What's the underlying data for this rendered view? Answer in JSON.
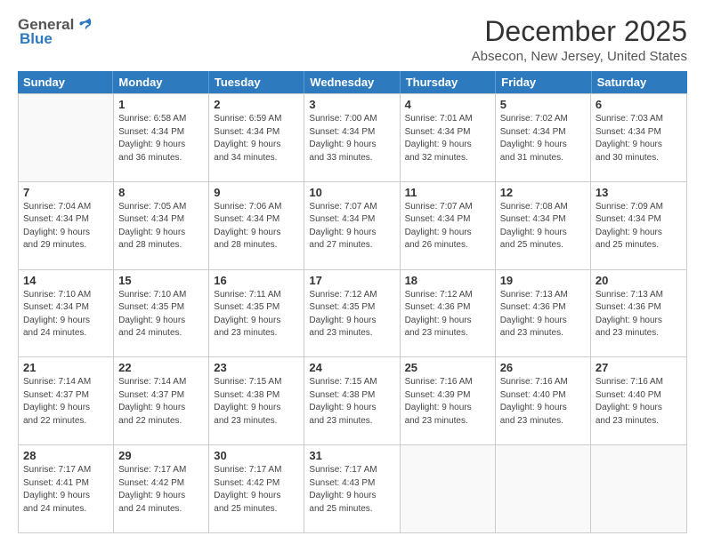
{
  "logo": {
    "general": "General",
    "blue": "Blue"
  },
  "title": "December 2025",
  "location": "Absecon, New Jersey, United States",
  "days_of_week": [
    "Sunday",
    "Monday",
    "Tuesday",
    "Wednesday",
    "Thursday",
    "Friday",
    "Saturday"
  ],
  "rows": [
    [
      {
        "day": "",
        "info": ""
      },
      {
        "day": "1",
        "info": "Sunrise: 6:58 AM\nSunset: 4:34 PM\nDaylight: 9 hours\nand 36 minutes."
      },
      {
        "day": "2",
        "info": "Sunrise: 6:59 AM\nSunset: 4:34 PM\nDaylight: 9 hours\nand 34 minutes."
      },
      {
        "day": "3",
        "info": "Sunrise: 7:00 AM\nSunset: 4:34 PM\nDaylight: 9 hours\nand 33 minutes."
      },
      {
        "day": "4",
        "info": "Sunrise: 7:01 AM\nSunset: 4:34 PM\nDaylight: 9 hours\nand 32 minutes."
      },
      {
        "day": "5",
        "info": "Sunrise: 7:02 AM\nSunset: 4:34 PM\nDaylight: 9 hours\nand 31 minutes."
      },
      {
        "day": "6",
        "info": "Sunrise: 7:03 AM\nSunset: 4:34 PM\nDaylight: 9 hours\nand 30 minutes."
      }
    ],
    [
      {
        "day": "7",
        "info": "Sunrise: 7:04 AM\nSunset: 4:34 PM\nDaylight: 9 hours\nand 29 minutes."
      },
      {
        "day": "8",
        "info": "Sunrise: 7:05 AM\nSunset: 4:34 PM\nDaylight: 9 hours\nand 28 minutes."
      },
      {
        "day": "9",
        "info": "Sunrise: 7:06 AM\nSunset: 4:34 PM\nDaylight: 9 hours\nand 28 minutes."
      },
      {
        "day": "10",
        "info": "Sunrise: 7:07 AM\nSunset: 4:34 PM\nDaylight: 9 hours\nand 27 minutes."
      },
      {
        "day": "11",
        "info": "Sunrise: 7:07 AM\nSunset: 4:34 PM\nDaylight: 9 hours\nand 26 minutes."
      },
      {
        "day": "12",
        "info": "Sunrise: 7:08 AM\nSunset: 4:34 PM\nDaylight: 9 hours\nand 25 minutes."
      },
      {
        "day": "13",
        "info": "Sunrise: 7:09 AM\nSunset: 4:34 PM\nDaylight: 9 hours\nand 25 minutes."
      }
    ],
    [
      {
        "day": "14",
        "info": "Sunrise: 7:10 AM\nSunset: 4:34 PM\nDaylight: 9 hours\nand 24 minutes."
      },
      {
        "day": "15",
        "info": "Sunrise: 7:10 AM\nSunset: 4:35 PM\nDaylight: 9 hours\nand 24 minutes."
      },
      {
        "day": "16",
        "info": "Sunrise: 7:11 AM\nSunset: 4:35 PM\nDaylight: 9 hours\nand 23 minutes."
      },
      {
        "day": "17",
        "info": "Sunrise: 7:12 AM\nSunset: 4:35 PM\nDaylight: 9 hours\nand 23 minutes."
      },
      {
        "day": "18",
        "info": "Sunrise: 7:12 AM\nSunset: 4:36 PM\nDaylight: 9 hours\nand 23 minutes."
      },
      {
        "day": "19",
        "info": "Sunrise: 7:13 AM\nSunset: 4:36 PM\nDaylight: 9 hours\nand 23 minutes."
      },
      {
        "day": "20",
        "info": "Sunrise: 7:13 AM\nSunset: 4:36 PM\nDaylight: 9 hours\nand 23 minutes."
      }
    ],
    [
      {
        "day": "21",
        "info": "Sunrise: 7:14 AM\nSunset: 4:37 PM\nDaylight: 9 hours\nand 22 minutes."
      },
      {
        "day": "22",
        "info": "Sunrise: 7:14 AM\nSunset: 4:37 PM\nDaylight: 9 hours\nand 22 minutes."
      },
      {
        "day": "23",
        "info": "Sunrise: 7:15 AM\nSunset: 4:38 PM\nDaylight: 9 hours\nand 23 minutes."
      },
      {
        "day": "24",
        "info": "Sunrise: 7:15 AM\nSunset: 4:38 PM\nDaylight: 9 hours\nand 23 minutes."
      },
      {
        "day": "25",
        "info": "Sunrise: 7:16 AM\nSunset: 4:39 PM\nDaylight: 9 hours\nand 23 minutes."
      },
      {
        "day": "26",
        "info": "Sunrise: 7:16 AM\nSunset: 4:40 PM\nDaylight: 9 hours\nand 23 minutes."
      },
      {
        "day": "27",
        "info": "Sunrise: 7:16 AM\nSunset: 4:40 PM\nDaylight: 9 hours\nand 23 minutes."
      }
    ],
    [
      {
        "day": "28",
        "info": "Sunrise: 7:17 AM\nSunset: 4:41 PM\nDaylight: 9 hours\nand 24 minutes."
      },
      {
        "day": "29",
        "info": "Sunrise: 7:17 AM\nSunset: 4:42 PM\nDaylight: 9 hours\nand 24 minutes."
      },
      {
        "day": "30",
        "info": "Sunrise: 7:17 AM\nSunset: 4:42 PM\nDaylight: 9 hours\nand 25 minutes."
      },
      {
        "day": "31",
        "info": "Sunrise: 7:17 AM\nSunset: 4:43 PM\nDaylight: 9 hours\nand 25 minutes."
      },
      {
        "day": "",
        "info": ""
      },
      {
        "day": "",
        "info": ""
      },
      {
        "day": "",
        "info": ""
      }
    ]
  ]
}
